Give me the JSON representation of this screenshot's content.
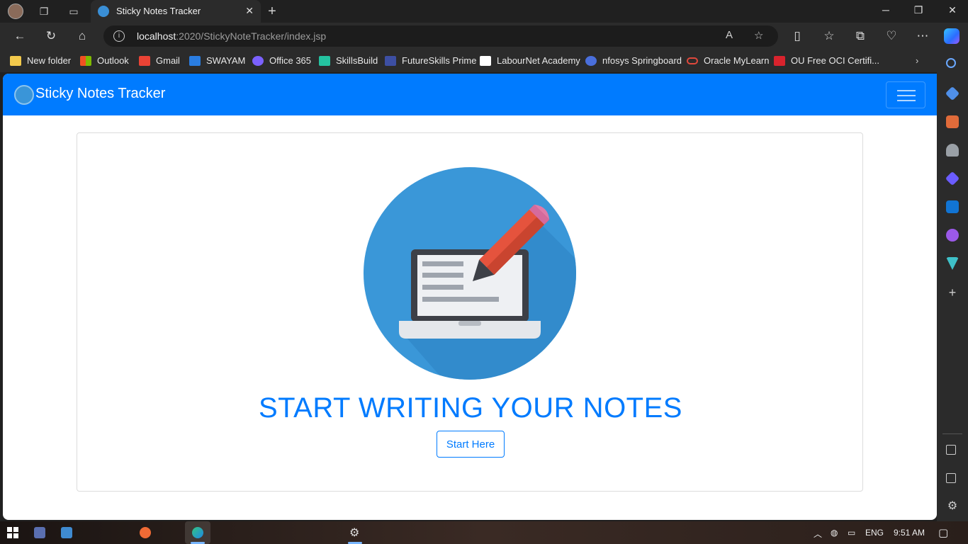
{
  "browser": {
    "tab_title": "Sticky Notes Tracker",
    "address": {
      "host": "localhost",
      "path": ":2020/StickyNoteTracker/index.jsp"
    },
    "bookmarks": [
      {
        "label": "New folder",
        "color": "#f2c94c"
      },
      {
        "label": "Outlook",
        "color": "#f25022"
      },
      {
        "label": "Gmail",
        "color": "#ea4335"
      },
      {
        "label": "SWAYAM",
        "color": "#2a7de1"
      },
      {
        "label": "Office 365",
        "color": "#7b61ff"
      },
      {
        "label": "SkillsBuild",
        "color": "#24c2a0"
      },
      {
        "label": "FutureSkills Prime",
        "color": "#3d4fa3"
      },
      {
        "label": "LabourNet Academy",
        "color": "#ffffff"
      },
      {
        "label": "nfosys Springboard",
        "color": "#4a6fdc"
      },
      {
        "label": "Oracle MyLearn",
        "color": "#e0483c"
      },
      {
        "label": "OU Free OCI Certifi...",
        "color": "#d9232d"
      }
    ]
  },
  "app": {
    "brand": "Sticky Notes Tracker",
    "headline": "START WRITING YOUR NOTES",
    "cta_label": "Start Here",
    "accent_color": "#007bff"
  },
  "taskbar": {
    "language": "ENG",
    "time": "9:51 AM"
  }
}
